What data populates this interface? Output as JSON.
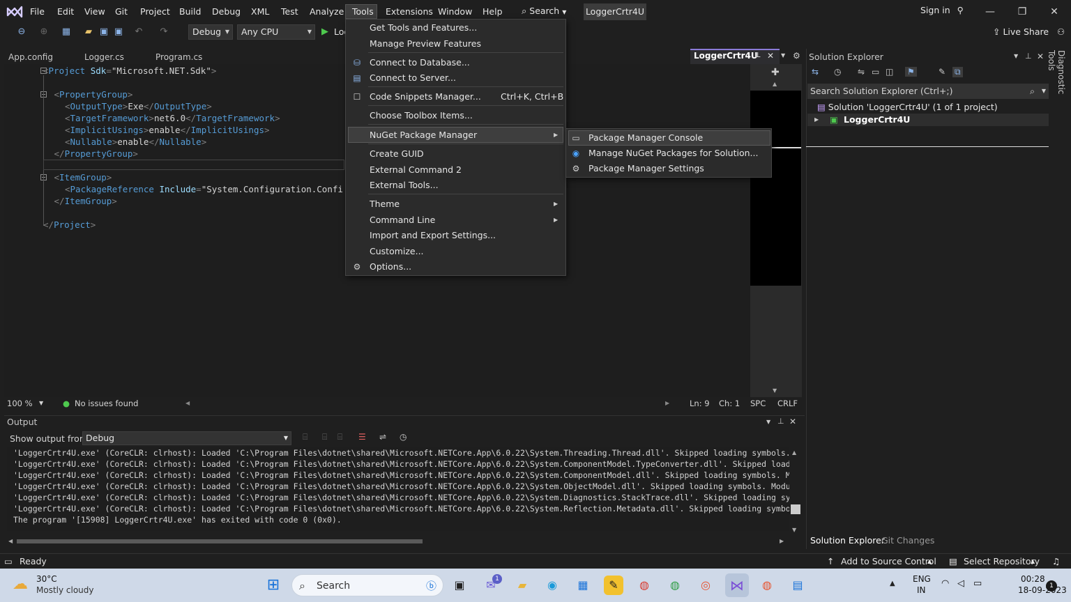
{
  "menubar": {
    "items": [
      "File",
      "Edit",
      "View",
      "Git",
      "Project",
      "Build",
      "Debug",
      "XML",
      "Test",
      "Analyze",
      "Tools",
      "Extensions",
      "Window",
      "Help"
    ],
    "search_label": "Search",
    "solution_name": "LoggerCrtr4U",
    "sign_in": "Sign in"
  },
  "toolbar": {
    "config": "Debug",
    "platform": "Any CPU",
    "start_label": "Log",
    "live_share": "Live Share"
  },
  "tabs": {
    "open": [
      "App.config",
      "Logger.cs",
      "Program.cs"
    ],
    "active": "LoggerCrtr4U"
  },
  "editor": {
    "lines": [
      {
        "indent": 0,
        "open": "<",
        "tag": "Project",
        "attr": " Sdk",
        "eq": "=",
        "val": "\"Microsoft.NET.Sdk\"",
        "close": ">"
      },
      {
        "indent": 1,
        "text": "<PropertyGroup>"
      },
      {
        "indent": 2,
        "text": "<OutputType>Exe</OutputType>"
      },
      {
        "indent": 2,
        "text": "<TargetFramework>net6.0</TargetFramework>"
      },
      {
        "indent": 2,
        "text": "<ImplicitUsings>enable</ImplicitUsings>"
      },
      {
        "indent": 2,
        "text": "<Nullable>enable</Nullable>"
      },
      {
        "indent": 1,
        "text": "</PropertyGroup>"
      },
      {
        "indent": 0,
        "text": ""
      },
      {
        "indent": 1,
        "text": "<ItemGroup>"
      },
      {
        "indent": 2,
        "text": "<PackageReference Include=\"System.Configuration.Confi"
      },
      {
        "indent": 1,
        "text": "</ItemGroup>"
      },
      {
        "indent": 0,
        "text": ""
      },
      {
        "indent": 0,
        "text": "</Project>"
      }
    ],
    "zoom": "100 %",
    "issues": "No issues found",
    "ln": "Ln: 9",
    "ch": "Ch: 1",
    "spc": "SPC",
    "eol": "CRLF"
  },
  "tools_menu": {
    "items": [
      {
        "label": "Get Tools and Features...",
        "icon": ""
      },
      {
        "label": "Manage Preview Features",
        "icon": ""
      },
      {
        "label": "Connect to Database...",
        "icon": "database-icon"
      },
      {
        "label": "Connect to Server...",
        "icon": "server-icon"
      },
      {
        "label": "Code Snippets Manager...",
        "icon": "snippet-icon",
        "shortcut": "Ctrl+K, Ctrl+B"
      },
      {
        "label": "Choose Toolbox Items...",
        "icon": ""
      },
      {
        "label": "NuGet Package Manager",
        "icon": "",
        "submenu": true
      },
      {
        "label": "Create GUID",
        "icon": ""
      },
      {
        "label": "External Command 2",
        "icon": ""
      },
      {
        "label": "External Tools...",
        "icon": ""
      },
      {
        "label": "Theme",
        "icon": "",
        "submenu": true
      },
      {
        "label": "Command Line",
        "icon": "",
        "submenu": true
      },
      {
        "label": "Import and Export Settings...",
        "icon": ""
      },
      {
        "label": "Customize...",
        "icon": ""
      },
      {
        "label": "Options...",
        "icon": "gear-icon"
      }
    ]
  },
  "nuget_submenu": {
    "items": [
      "Package Manager Console",
      "Manage NuGet Packages for Solution...",
      "Package Manager Settings"
    ]
  },
  "solution_explorer": {
    "title": "Solution Explorer",
    "search_placeholder": "Search Solution Explorer (Ctrl+;)",
    "solution_row": "Solution 'LoggerCrtr4U' (1 of 1 project)",
    "project_row": "LoggerCrtr4U",
    "bottom_tabs": [
      "Solution Explorer",
      "Git Changes"
    ],
    "side_tab": "Diagnostic Tools"
  },
  "output": {
    "title": "Output",
    "show_from_label": "Show output from:",
    "source": "Debug",
    "lines": [
      "'LoggerCrtr4U.exe' (CoreCLR: clrhost): Loaded 'C:\\Program Files\\dotnet\\shared\\Microsoft.NETCore.App\\6.0.22\\System.Threading.Thread.dll'. Skipped loading symbols. Module is op",
      "'LoggerCrtr4U.exe' (CoreCLR: clrhost): Loaded 'C:\\Program Files\\dotnet\\shared\\Microsoft.NETCore.App\\6.0.22\\System.ComponentModel.TypeConverter.dll'. Skipped loading symbols.",
      "'LoggerCrtr4U.exe' (CoreCLR: clrhost): Loaded 'C:\\Program Files\\dotnet\\shared\\Microsoft.NETCore.App\\6.0.22\\System.ComponentModel.dll'. Skipped loading symbols. Module is opti",
      "'LoggerCrtr4U.exe' (CoreCLR: clrhost): Loaded 'C:\\Program Files\\dotnet\\shared\\Microsoft.NETCore.App\\6.0.22\\System.ObjectModel.dll'. Skipped loading symbols. Module is optimiz",
      "'LoggerCrtr4U.exe' (CoreCLR: clrhost): Loaded 'C:\\Program Files\\dotnet\\shared\\Microsoft.NETCore.App\\6.0.22\\System.Diagnostics.StackTrace.dll'. Skipped loading symbols. Module",
      "'LoggerCrtr4U.exe' (CoreCLR: clrhost): Loaded 'C:\\Program Files\\dotnet\\shared\\Microsoft.NETCore.App\\6.0.22\\System.Reflection.Metadata.dll'. Skipped loading symbols. Module is",
      "The program '[15908] LoggerCrtr4U.exe' has exited with code 0 (0x0)."
    ]
  },
  "statusbar": {
    "ready": "Ready",
    "source_control": "Add to Source Control",
    "repository": "Select Repository"
  },
  "taskbar": {
    "temp": "30°C",
    "weather": "Mostly cloudy",
    "search": "Search",
    "lang_top": "ENG",
    "lang_bottom": "IN",
    "time": "00:28",
    "date": "18-09-2023",
    "notification_count": "1",
    "teams_badge": "1"
  },
  "colors": {
    "accent": "#8b7bd8",
    "bg": "#1f1f1f",
    "menu_bg": "#2b2b2b"
  }
}
